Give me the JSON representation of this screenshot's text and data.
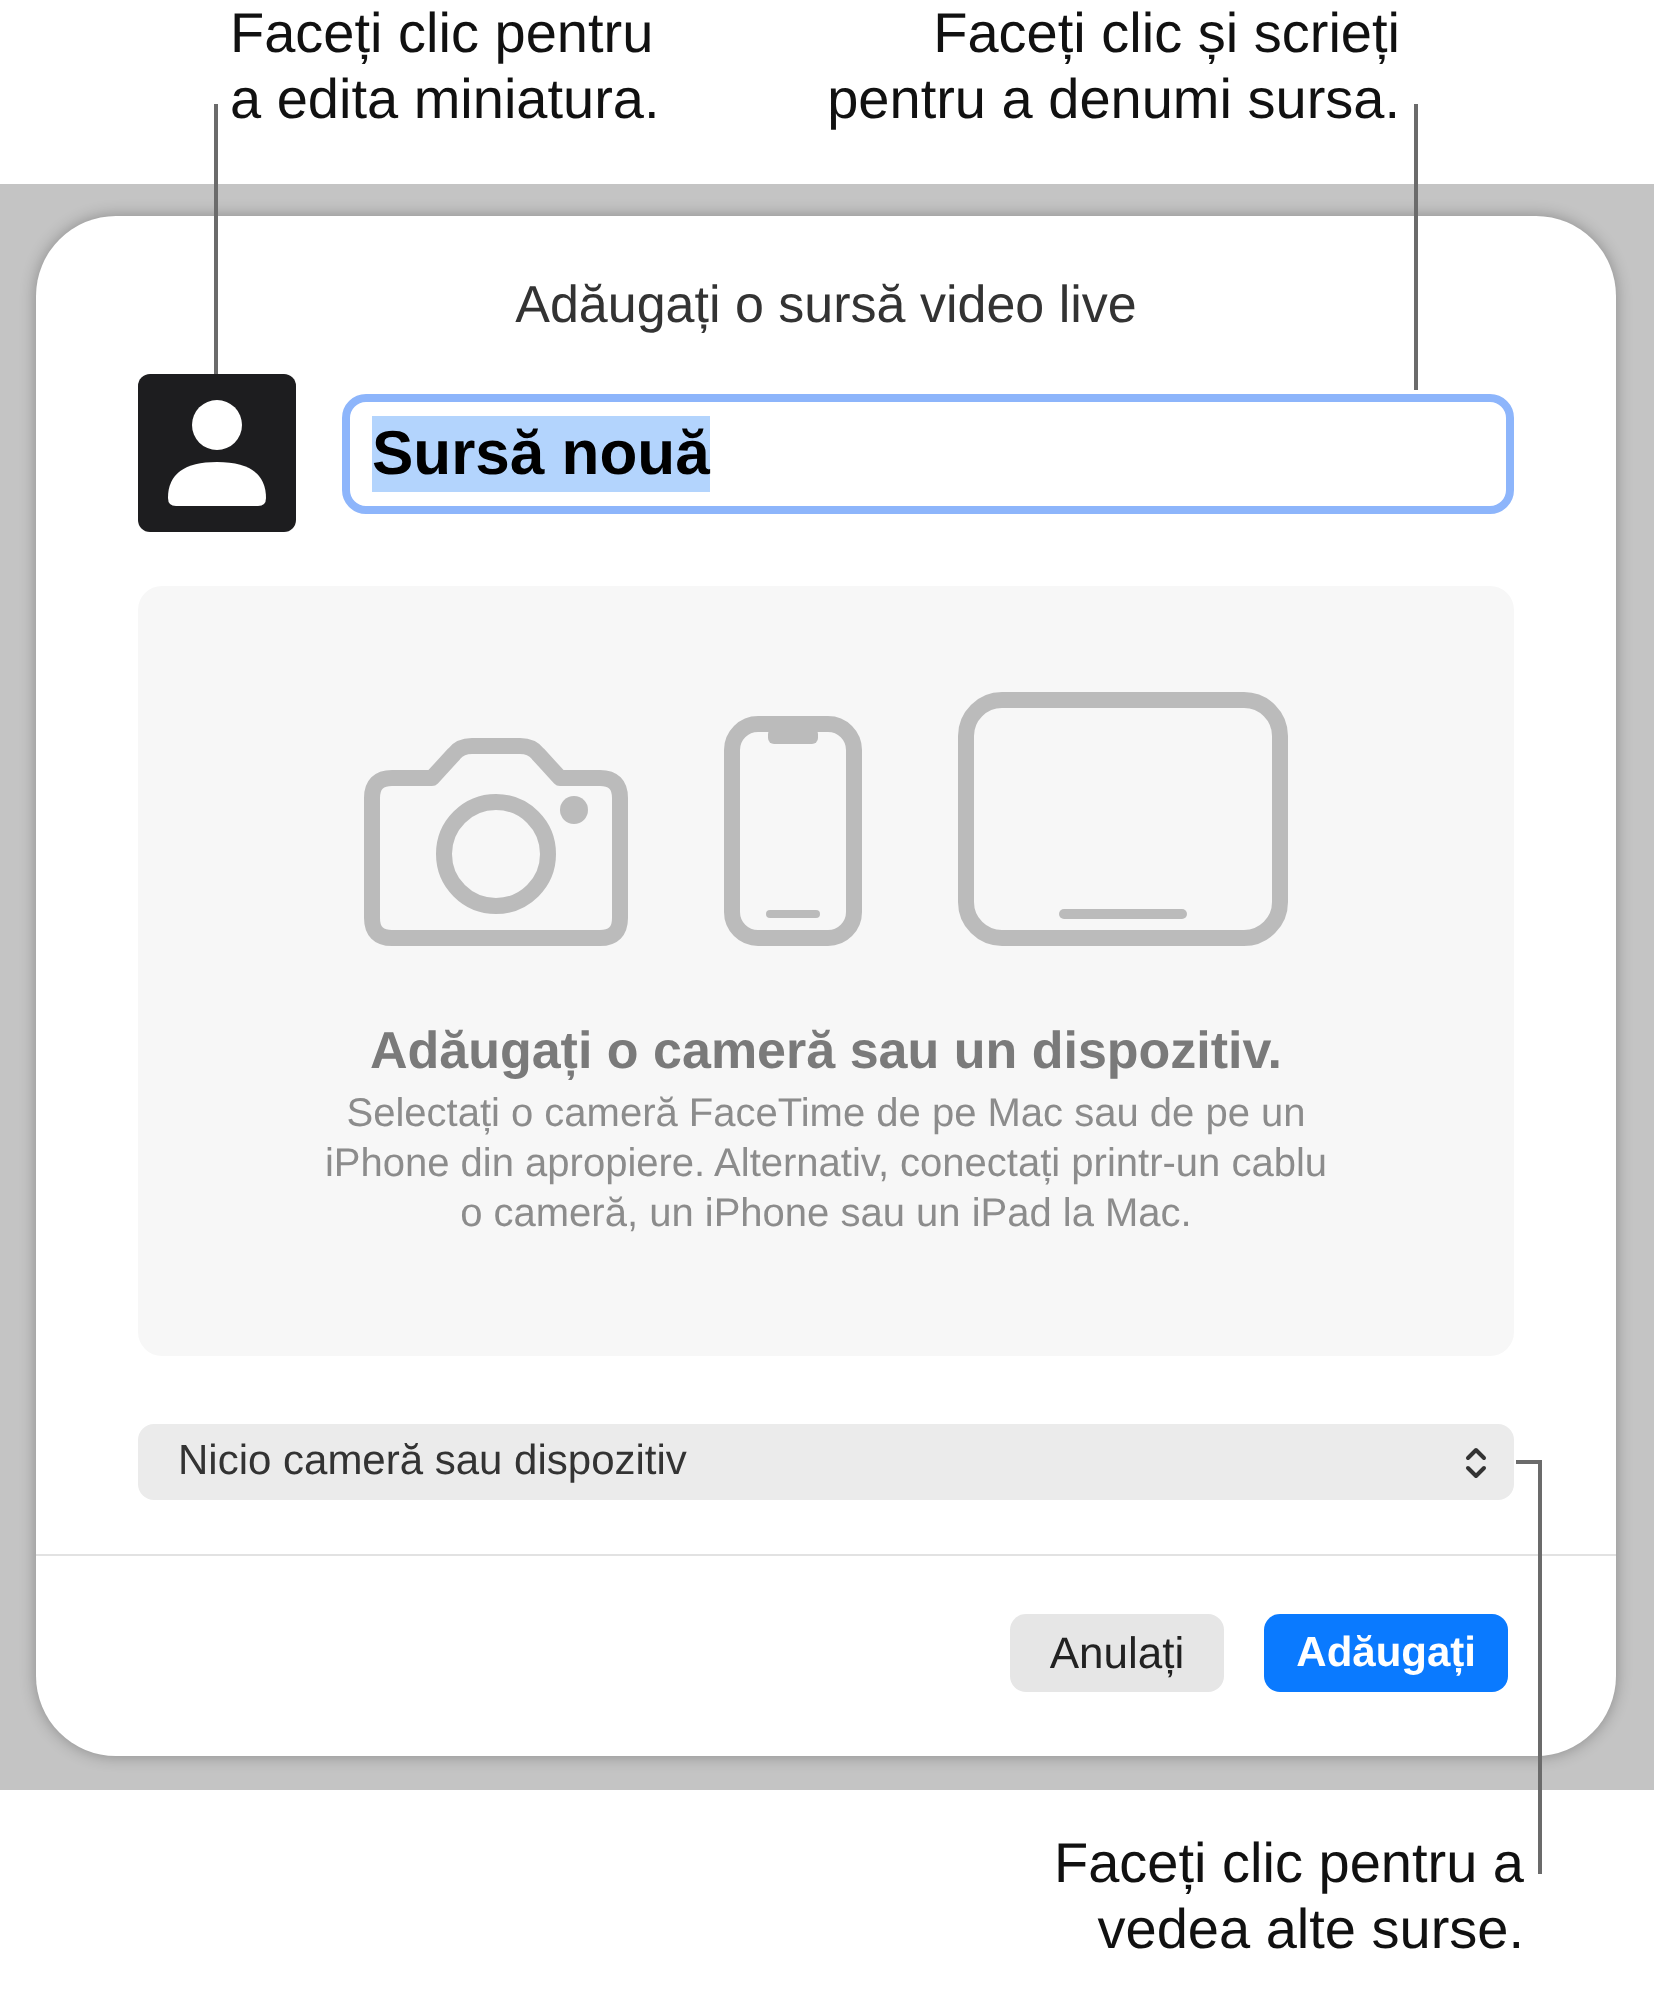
{
  "callouts": {
    "thumbnail": "Faceți clic pentru\na edita miniatura.",
    "name_field": "Faceți clic și scrieți\npentru a denumi sursa.",
    "source_menu": "Faceți clic pentru a\nvedea alte surse."
  },
  "dialog": {
    "title": "Adăugați o sursă video live",
    "name_field": {
      "value": "Sursă nouă",
      "focused": true,
      "text_selected": true
    },
    "empty_state": {
      "heading": "Adăugați o cameră sau un dispozitiv.",
      "body": "Selectați o cameră FaceTime de pe Mac sau de pe un\niPhone din apropiere. Alternativ, conectați printr-un cablu\no cameră, un iPhone sau un iPad la Mac."
    },
    "source_menu": {
      "value": "Nicio cameră sau dispozitiv"
    },
    "buttons": [
      {
        "label": "Anulați",
        "default": false
      },
      {
        "label": "Adăugați",
        "default": true
      }
    ]
  }
}
